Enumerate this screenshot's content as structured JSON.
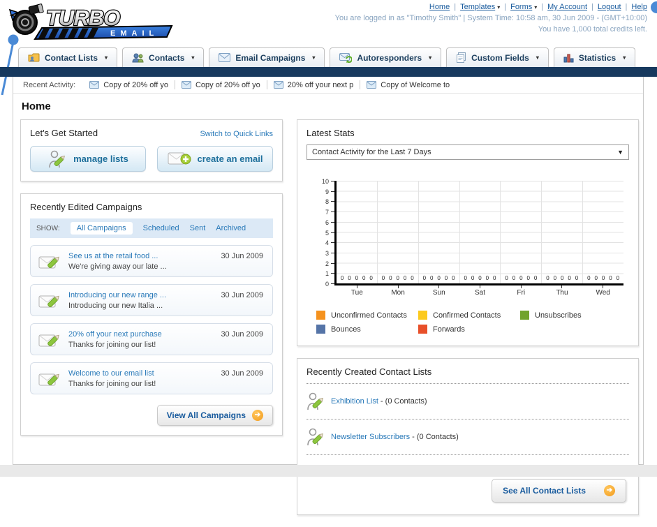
{
  "header": {
    "logo_title": "TURBO",
    "logo_subtitle": "EMAIL",
    "links": [
      {
        "label": "Home",
        "dropdown": false
      },
      {
        "label": "Templates",
        "dropdown": true
      },
      {
        "label": "Forms",
        "dropdown": true
      },
      {
        "label": "My Account",
        "dropdown": false
      },
      {
        "label": "Logout",
        "dropdown": false
      },
      {
        "label": "Help",
        "dropdown": false
      }
    ],
    "login_line": "You are logged in as \"Timothy Smith\" | System Time: 10:58 am, 30 Jun 2009 - (GMT+10:00)",
    "credits_line": "You have 1,000 total credits left."
  },
  "nav": {
    "tabs": [
      {
        "label": "Contact Lists",
        "icon": "contact-lists-icon"
      },
      {
        "label": "Contacts",
        "icon": "contacts-icon"
      },
      {
        "label": "Email Campaigns",
        "icon": "email-campaigns-icon"
      },
      {
        "label": "Autoresponders",
        "icon": "autoresponders-icon"
      },
      {
        "label": "Custom Fields",
        "icon": "custom-fields-icon"
      },
      {
        "label": "Statistics",
        "icon": "statistics-icon"
      }
    ]
  },
  "recent_activity": {
    "label": "Recent Activity:",
    "items": [
      "Copy of 20% off yo",
      "Copy of 20% off yo",
      "20% off your next p",
      "Copy of Welcome to"
    ]
  },
  "page": {
    "title": "Home"
  },
  "get_started": {
    "title": "Let's Get Started",
    "switch_link": "Switch to Quick Links",
    "buttons": [
      {
        "label": "manage lists",
        "icon": "manage-lists-icon"
      },
      {
        "label": "create an email",
        "icon": "create-email-icon"
      }
    ]
  },
  "campaigns": {
    "title": "Recently Edited Campaigns",
    "show_label": "SHOW:",
    "tabs": [
      "All Campaigns",
      "Scheduled",
      "Sent",
      "Archived"
    ],
    "active_tab": "All Campaigns",
    "items": [
      {
        "title": "See us at the retail food ...",
        "subtitle": "We're giving away our late ...",
        "date": "30 Jun 2009"
      },
      {
        "title": "Introducing our new range ...",
        "subtitle": "Introducing our new Italia ...",
        "date": "30 Jun 2009"
      },
      {
        "title": "20% off your next purchase",
        "subtitle": "Thanks for joining our list!",
        "date": "30 Jun 2009"
      },
      {
        "title": "Welcome to our email list",
        "subtitle": "Thanks for joining our list!",
        "date": "30 Jun 2009"
      }
    ],
    "view_all_label": "View All Campaigns"
  },
  "stats": {
    "title": "Latest Stats",
    "dropdown_value": "Contact Activity for the Last 7 Days"
  },
  "chart_data": {
    "type": "bar",
    "title": "Contact Activity for the Last 7 Days",
    "categories": [
      "Tue",
      "Mon",
      "Sun",
      "Sat",
      "Fri",
      "Thu",
      "Wed"
    ],
    "series": [
      {
        "name": "Unconfirmed Contacts",
        "color": "#f5921e",
        "values": [
          0,
          0,
          0,
          0,
          0,
          0,
          0
        ]
      },
      {
        "name": "Confirmed Contacts",
        "color": "#fcca1f",
        "values": [
          0,
          0,
          0,
          0,
          0,
          0,
          0
        ]
      },
      {
        "name": "Unsubscribes",
        "color": "#71a32c",
        "values": [
          0,
          0,
          0,
          0,
          0,
          0,
          0
        ]
      },
      {
        "name": "Bounces",
        "color": "#5574a7",
        "values": [
          0,
          0,
          0,
          0,
          0,
          0,
          0
        ]
      },
      {
        "name": "Forwards",
        "color": "#e8502a",
        "values": [
          0,
          0,
          0,
          0,
          0,
          0,
          0
        ]
      }
    ],
    "ylim": [
      0,
      10
    ],
    "yticks": [
      10,
      9,
      8,
      7,
      6,
      5,
      4,
      3,
      2,
      1,
      0
    ],
    "grid": true,
    "legend_position": "bottom"
  },
  "contact_lists": {
    "title": "Recently Created Contact Lists",
    "items": [
      {
        "name": "Exhibition List",
        "detail": "- (0 Contacts)"
      },
      {
        "name": "Newsletter Subscribers",
        "detail": "- (0 Contacts)"
      }
    ],
    "see_all_label": "See All Contact Lists"
  },
  "colors": {
    "navy_bar": "#17395e",
    "link_blue": "#1a5c9e",
    "light_link_blue": "#2a7ab9",
    "accent_orange": "#f29b1d",
    "pin_blue": "#4a8ad6"
  }
}
